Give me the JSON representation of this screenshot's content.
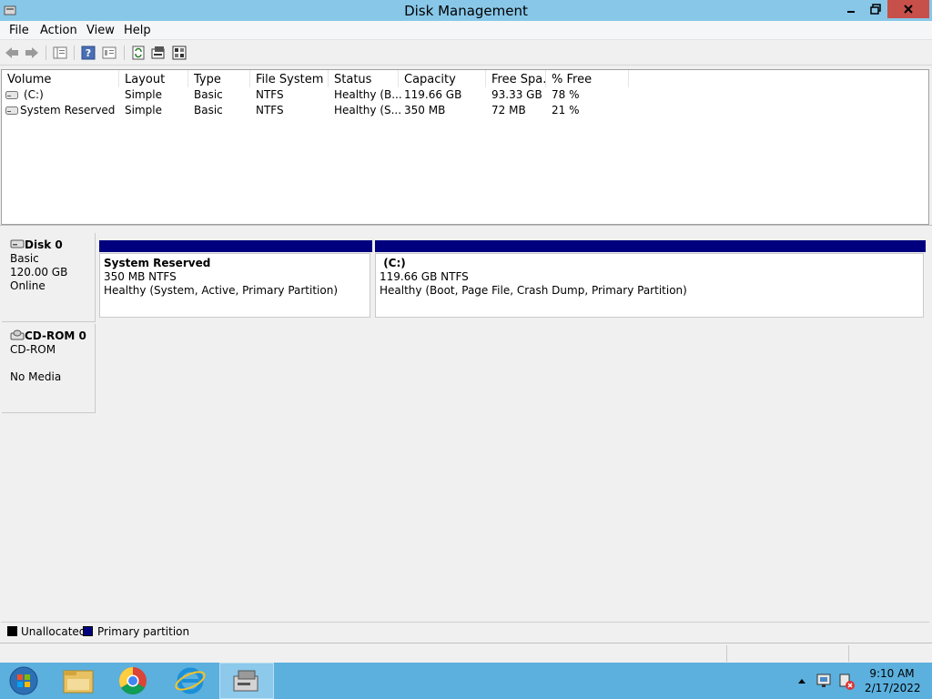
{
  "window": {
    "title": "Disk Management"
  },
  "menu": {
    "file": "File",
    "action": "Action",
    "view": "View",
    "help": "Help"
  },
  "toolbar": {
    "icons": [
      "back-arrow-icon",
      "forward-arrow-icon",
      "console-tree-icon",
      "help-icon",
      "properties-icon",
      "refresh-icon",
      "rescan-disks-icon",
      "settings-icon"
    ]
  },
  "volume_list": {
    "columns": [
      "Volume",
      "Layout",
      "Type",
      "File System",
      "Status",
      "Capacity",
      "Free Spa...",
      "% Free"
    ],
    "rows": [
      {
        "volume": "(C:)",
        "layout": "Simple",
        "type": "Basic",
        "fs": "NTFS",
        "status": "Healthy (B...",
        "capacity": "119.66 GB",
        "free": "93.33 GB",
        "pct": "78 %"
      },
      {
        "volume": "System Reserved",
        "layout": "Simple",
        "type": "Basic",
        "fs": "NTFS",
        "status": "Healthy (S...",
        "capacity": "350 MB",
        "free": "72 MB",
        "pct": "21 %"
      }
    ]
  },
  "disks": [
    {
      "name": "Disk 0",
      "kind": "Basic",
      "size": "120.00 GB",
      "state": "Online",
      "partitions": [
        {
          "title": "System Reserved",
          "size_fs": "350 MB NTFS",
          "health": "Healthy (System, Active, Primary Partition)"
        },
        {
          "title": "(C:)",
          "size_fs": "119.66 GB NTFS",
          "health": "Healthy (Boot, Page File, Crash Dump, Primary Partition)"
        }
      ]
    },
    {
      "name": "CD-ROM 0",
      "kind": "CD-ROM",
      "size": "",
      "state": "No Media"
    }
  ],
  "legend": {
    "unallocated": "Unallocated",
    "primary": "Primary partition"
  },
  "colors": {
    "primary_partition": "#00007f",
    "unallocated": "#000000",
    "taskbar": "#5bb0de",
    "titlebar": "#88c7e8",
    "close": "#c7504a"
  },
  "taskbar": {
    "items": [
      "start-icon",
      "file-explorer-icon",
      "chrome-icon",
      "internet-explorer-icon",
      "disk-management-icon"
    ],
    "time": "9:10 AM",
    "date": "2/17/2022"
  }
}
